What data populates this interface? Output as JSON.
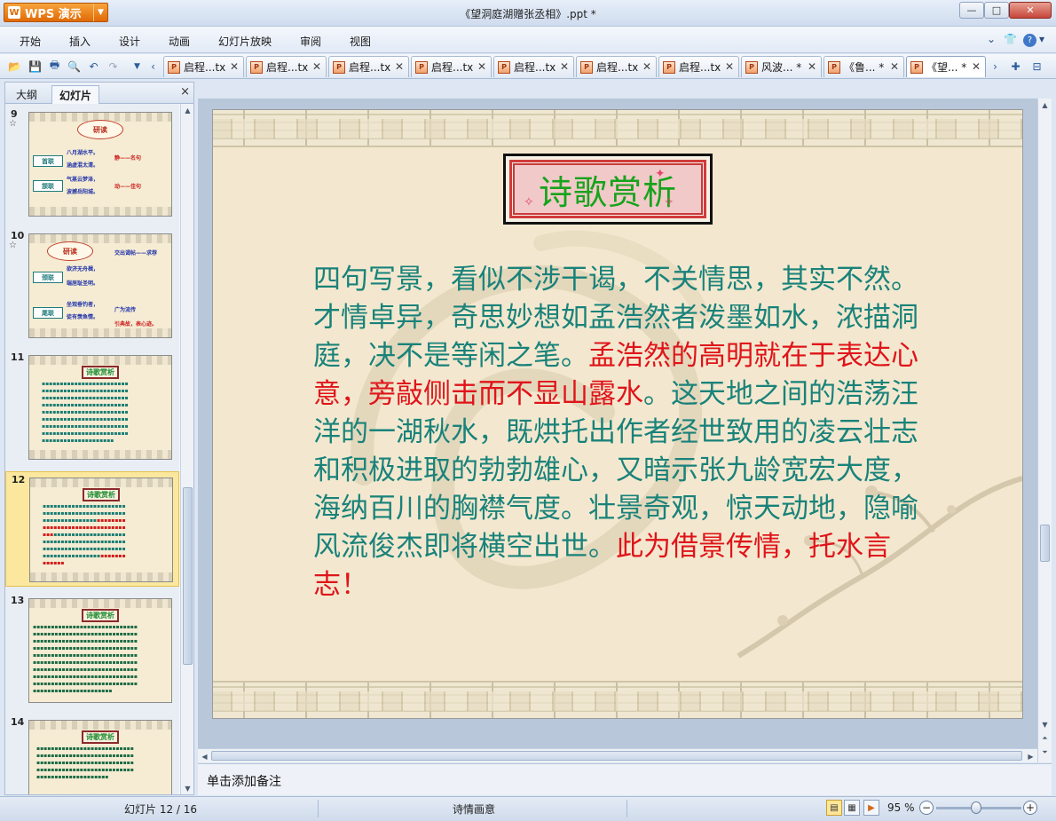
{
  "app": {
    "name": "WPS 演示",
    "document_title": "《望洞庭湖赠张丞相》.ppt *"
  },
  "window_controls": {
    "minimize": "—",
    "maximize": "□",
    "close": "✕"
  },
  "menu": {
    "items": [
      "开始",
      "插入",
      "设计",
      "动画",
      "幻灯片放映",
      "审阅",
      "视图"
    ],
    "right_icons": [
      "chevron-down",
      "shirt",
      "help"
    ]
  },
  "doc_tabs": [
    {
      "label": "启程...tx",
      "active": false
    },
    {
      "label": "启程...tx",
      "active": false
    },
    {
      "label": "启程...tx",
      "active": false
    },
    {
      "label": "启程...tx",
      "active": false
    },
    {
      "label": "启程...tx",
      "active": false
    },
    {
      "label": "启程...tx",
      "active": false
    },
    {
      "label": "启程...tx",
      "active": false
    },
    {
      "label": "风波... *",
      "active": false
    },
    {
      "label": "《鲁... *",
      "active": false
    },
    {
      "label": "《望... *",
      "active": true
    }
  ],
  "left_panel": {
    "tabs": [
      "大纲",
      "幻灯片"
    ],
    "active_tab": "幻灯片",
    "close": "×",
    "slides": [
      {
        "number": "9",
        "title": "研读",
        "labels": [
          "首联",
          "颔联"
        ],
        "lines": [
          "八月湖水平。",
          "涵虚混太清。",
          "气蒸云梦泽，",
          "波撼岳阳城。"
        ],
        "notes": [
          "静——名句",
          "动——佳句"
        ]
      },
      {
        "number": "10",
        "title": "研读",
        "labels": [
          "颈联",
          "尾联"
        ],
        "lines": [
          "欲济无舟楫，",
          "端居耻圣明。",
          "坐观垂钓者，",
          "徒有羡鱼情。"
        ],
        "notes": [
          "交出谒帖——求荐",
          "广为流传",
          "引典故，表心迹。"
        ]
      },
      {
        "number": "11",
        "title": "诗歌赏析"
      },
      {
        "number": "12",
        "title": "诗歌赏析",
        "selected": true
      },
      {
        "number": "13",
        "title": "诗歌赏析"
      },
      {
        "number": "14",
        "title": "诗歌赏析"
      }
    ]
  },
  "slide": {
    "title": "诗歌赏析",
    "body_segments": [
      {
        "text": "四句写景，看似不涉干谒，不关情思，其实不然。才情卓异，奇思妙想如孟浩然者泼墨如水，浓描洞庭，决不是等闲之笔。",
        "color": "teal"
      },
      {
        "text": "孟浩然的高明就在于表达心意，旁敲侧击而不显山露水",
        "color": "red"
      },
      {
        "text": "。这天地之间的浩荡汪洋的一湖秋水，既烘托出作者经世致用的凌云壮志和积极进取的勃勃雄心，又暗示张九龄宽宏大度，海纳百川的胸襟气度。壮景奇观，惊天动地，隐喻风流俊杰即将横空出世。",
        "color": "teal"
      },
      {
        "text": "此为借景传情，托水言志！",
        "color": "red"
      }
    ]
  },
  "notes": {
    "placeholder": "单击添加备注"
  },
  "status": {
    "slide_counter": "幻灯片 12 / 16",
    "theme": "诗情画意",
    "zoom": "95 %",
    "zoom_minus": "−",
    "zoom_plus": "+"
  }
}
